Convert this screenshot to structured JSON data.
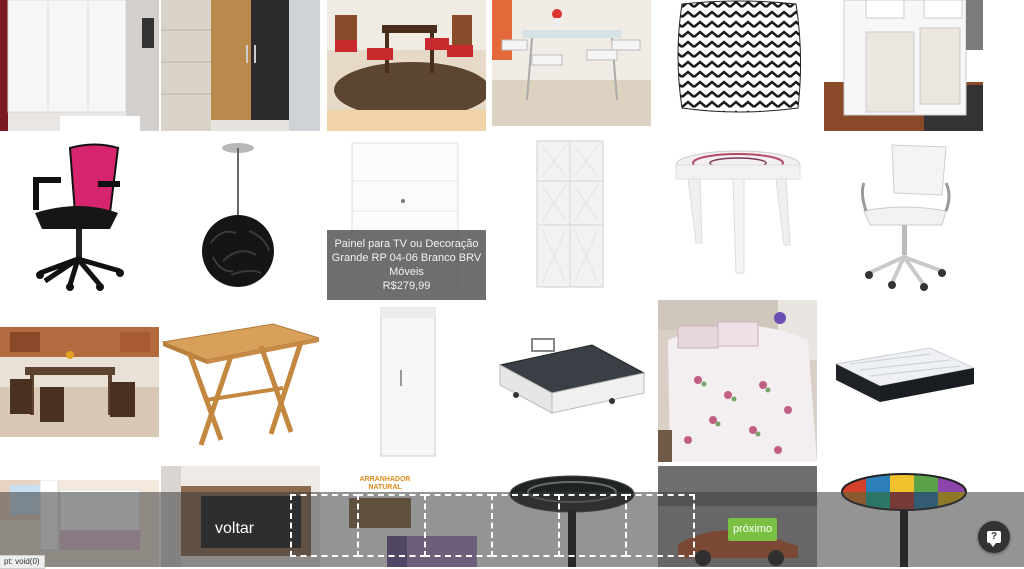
{
  "tooltip": {
    "title": "Painel para TV ou Decoração Grande RP 04-06 Branco BRV Móveis",
    "price": "R$279,99"
  },
  "nav": {
    "back_label": "voltar",
    "next_label": "próximo"
  },
  "help": {
    "icon": "help-chat-icon",
    "glyph": "?"
  },
  "status": {
    "text": "pt: void(0)"
  },
  "featured_logo": {
    "text": "ARRANHADOR NATURAL"
  },
  "colors": {
    "overlay": "#3c3c3c",
    "next_button": "#7ac143",
    "help_button": "#333333",
    "chair_mesh": "#d6246e"
  }
}
